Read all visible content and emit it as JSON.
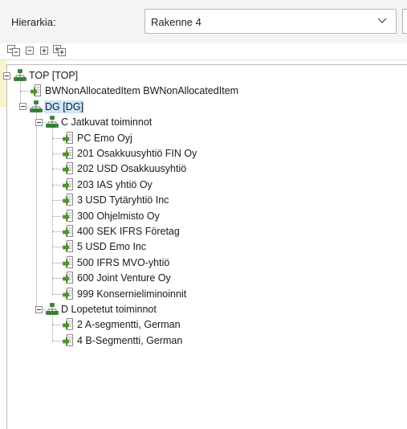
{
  "header": {
    "hierarchy_label": "Hierarkia:",
    "structure_select": {
      "value": "Rakenne 4",
      "icon": "chevron-down-icon"
    }
  },
  "toolbar": {
    "buttons": [
      {
        "icon": "collapse-all-icon"
      },
      {
        "icon": "collapse-icon"
      },
      {
        "icon": "expand-icon"
      },
      {
        "icon": "expand-all-icon"
      }
    ]
  },
  "tree": {
    "nodes": [
      {
        "label": "TOP [TOP]",
        "level": 0,
        "type": "group",
        "expanded": true
      },
      {
        "label": "BWNonAllocatedItem BWNonAllocatedItem",
        "level": 1,
        "type": "leaf"
      },
      {
        "label": "DG [DG]",
        "level": 1,
        "type": "group",
        "expanded": true,
        "selected": true
      },
      {
        "label": "C Jatkuvat toiminnot",
        "level": 2,
        "type": "group",
        "expanded": true
      },
      {
        "label": "PC Emo Oyj",
        "level": 3,
        "type": "leaf"
      },
      {
        "label": "201 Osakkuusyhtiö FIN Oy",
        "level": 3,
        "type": "leaf"
      },
      {
        "label": "202 USD Osakkuusyhtiö",
        "level": 3,
        "type": "leaf"
      },
      {
        "label": "203 IAS yhtiö Oy",
        "level": 3,
        "type": "leaf"
      },
      {
        "label": "3 USD Tytäryhtiö Inc",
        "level": 3,
        "type": "leaf"
      },
      {
        "label": "300 Ohjelmisto Oy",
        "level": 3,
        "type": "leaf"
      },
      {
        "label": "400 SEK IFRS Företag",
        "level": 3,
        "type": "leaf"
      },
      {
        "label": "5 USD Emo Inc",
        "level": 3,
        "type": "leaf"
      },
      {
        "label": "500 IFRS MVO-yhtiö",
        "level": 3,
        "type": "leaf"
      },
      {
        "label": "600 Joint Venture Oy",
        "level": 3,
        "type": "leaf"
      },
      {
        "label": "999 Konsernieliminoinnit",
        "level": 3,
        "type": "leaf"
      },
      {
        "label": "D Lopetetut toiminnot",
        "level": 2,
        "type": "group",
        "expanded": true
      },
      {
        "label": "2 A-segmentti, German",
        "level": 3,
        "type": "leaf"
      },
      {
        "label": "4 B-Segmentti, German",
        "level": 3,
        "type": "leaf"
      }
    ],
    "colors": {
      "selection": "#cce6fb",
      "leaf_icon": "#4e9a2a",
      "group_icon": "#2e8b2e"
    }
  }
}
